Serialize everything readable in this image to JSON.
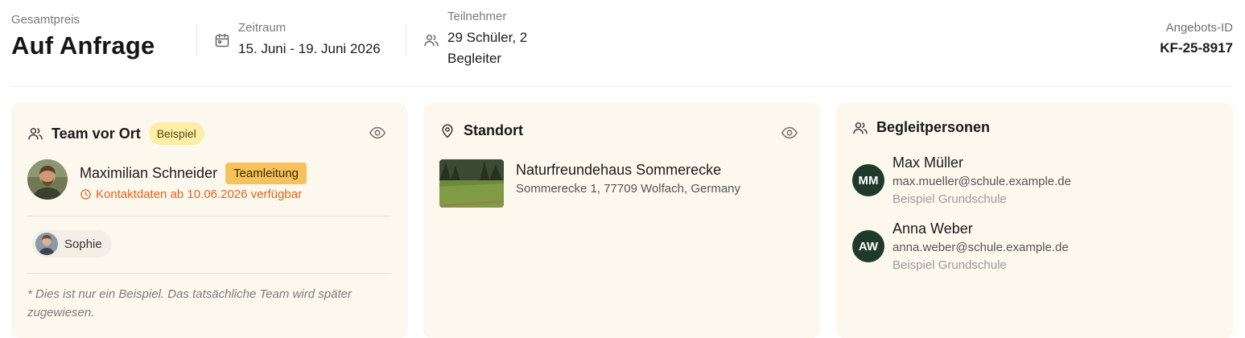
{
  "header": {
    "price_label": "Gesamtpreis",
    "price_value": "Auf Anfrage",
    "period_label": "Zeitraum",
    "period_value": "15. Juni - 19. Juni 2026",
    "participants_label": "Teilnehmer",
    "participants_line1": "29 Schüler, 2",
    "participants_line2": "Begleiter",
    "offer_label": "Angebots-ID",
    "offer_value": "KF-25-8917"
  },
  "team": {
    "title": "Team vor Ort",
    "badge": "Beispiel",
    "icon": "users-icon",
    "leader_name": "Maximilian Schneider",
    "leader_role": "Teamleitung",
    "contact_note": "Kontaktdaten ab 10.06.2026 verfügbar",
    "member_name": "Sophie",
    "note": "* Dies ist nur ein Beispiel. Das tatsächliche Team wird später zugewiesen.",
    "accent_color": "#e0641f"
  },
  "location": {
    "title": "Standort",
    "icon": "map-pin-icon",
    "name": "Naturfreundehaus Sommerecke",
    "address": "Sommerecke 1, 77709 Wolfach, Germany"
  },
  "companions": {
    "title": "Begleitpersonen",
    "icon": "users-icon",
    "people": [
      {
        "initials": "MM",
        "name": "Max Müller",
        "email": "max.mueller@schule.example.de",
        "school": "Beispiel Grundschule"
      },
      {
        "initials": "AW",
        "name": "Anna Weber",
        "email": "anna.weber@schule.example.de",
        "school": "Beispiel Grundschule"
      }
    ]
  },
  "colors": {
    "card_bg": "#fdf8ee",
    "badge_yellow": "#fbeea7",
    "badge_lead": "#f7c25d",
    "avatar_green": "#1f3a2a"
  }
}
